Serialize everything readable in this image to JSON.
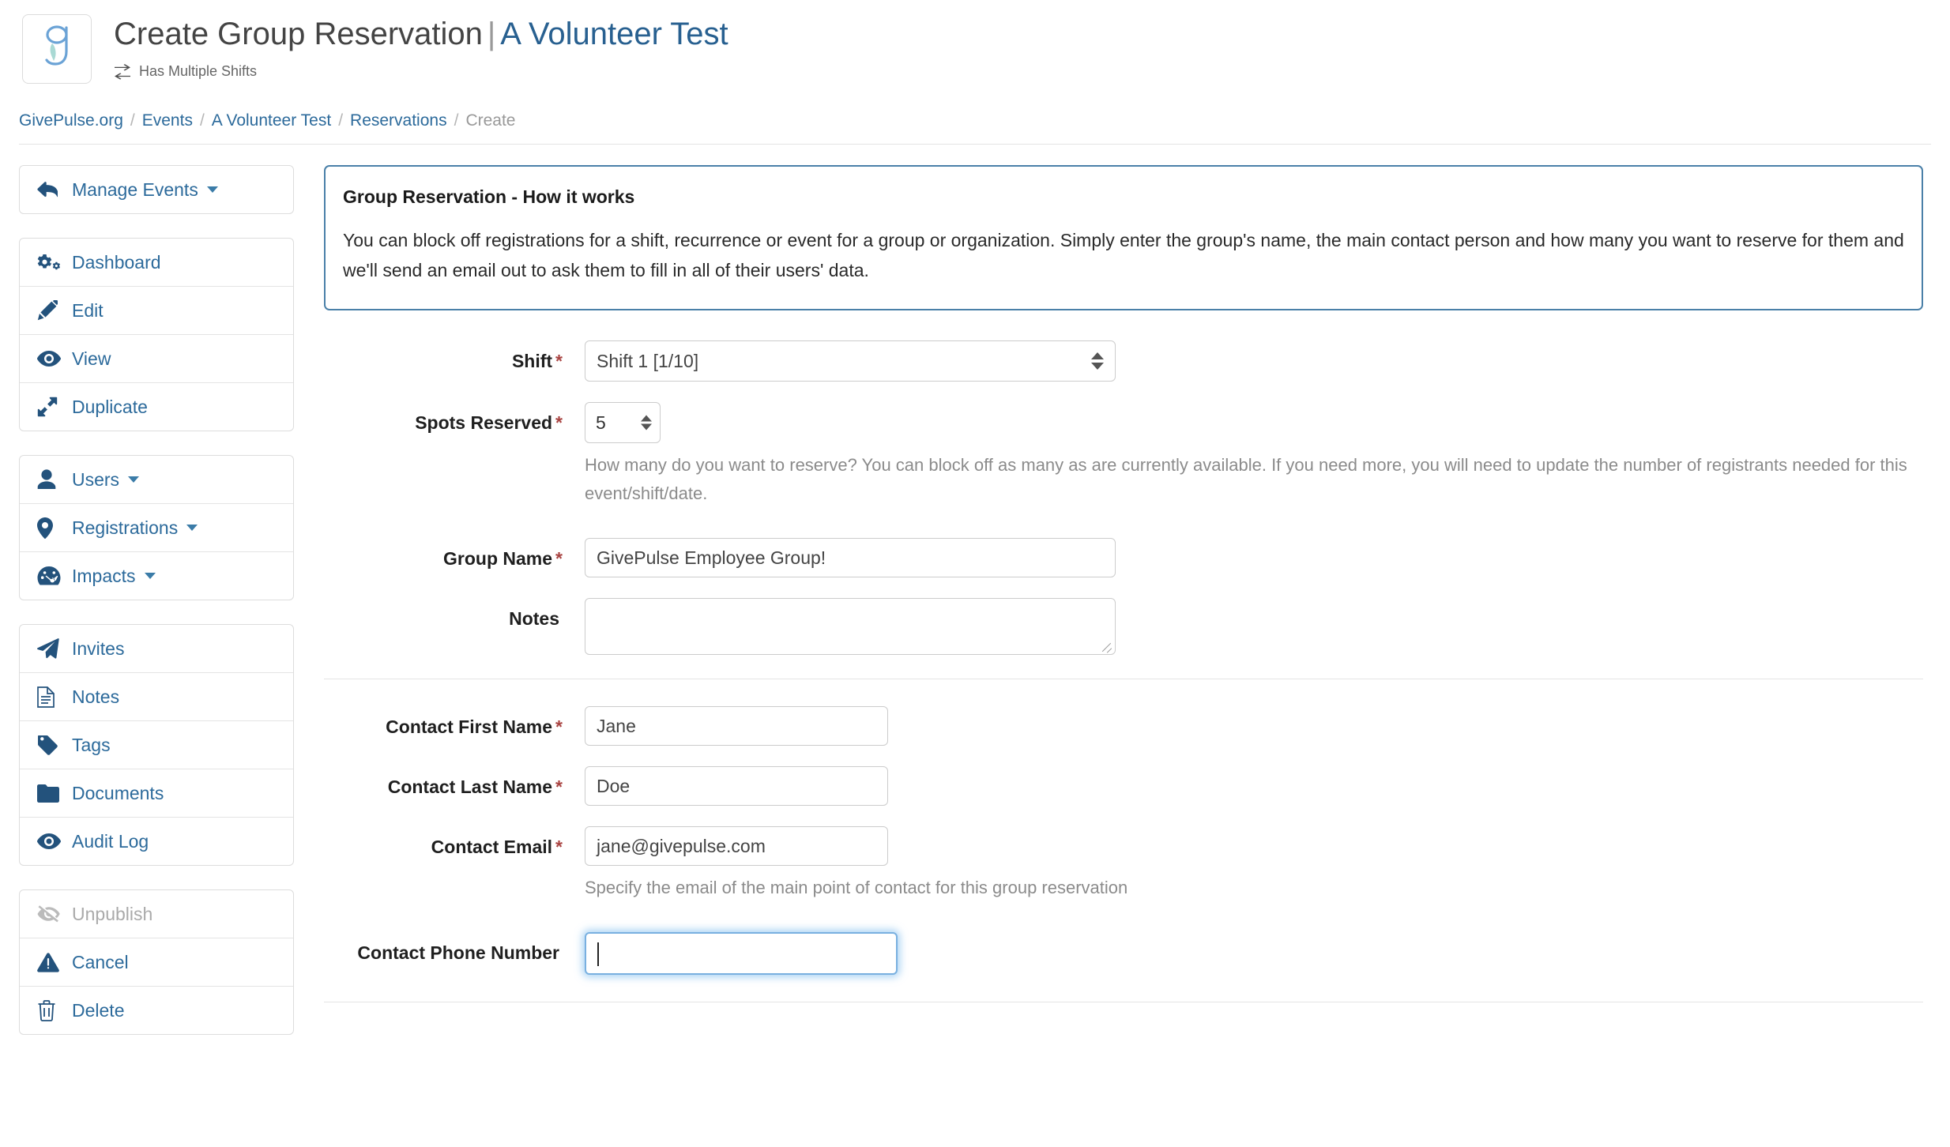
{
  "header": {
    "logo_icon": "givepulse-g-logo",
    "title_main": "Create Group Reservation",
    "title_separator": "|",
    "title_sub": "A Volunteer Test",
    "badge_icon": "exchange-arrows-icon",
    "badge_label": "Has Multiple Shifts"
  },
  "breadcrumb": {
    "items": [
      {
        "label": "GivePulse.org",
        "current": false
      },
      {
        "label": "Events",
        "current": false
      },
      {
        "label": "A Volunteer Test",
        "current": false
      },
      {
        "label": "Reservations",
        "current": false
      },
      {
        "label": "Create",
        "current": true
      }
    ],
    "separator": "/"
  },
  "sidebar": {
    "groups": [
      {
        "items": [
          {
            "label": "Manage Events",
            "icon": "back-arrow-icon",
            "caret": true,
            "disabled": false
          }
        ]
      },
      {
        "items": [
          {
            "label": "Dashboard",
            "icon": "gears-icon",
            "caret": false,
            "disabled": false
          },
          {
            "label": "Edit",
            "icon": "pencil-icon",
            "caret": false,
            "disabled": false
          },
          {
            "label": "View",
            "icon": "eye-icon",
            "caret": false,
            "disabled": false
          },
          {
            "label": "Duplicate",
            "icon": "expand-arrows-icon",
            "caret": false,
            "disabled": false
          }
        ]
      },
      {
        "items": [
          {
            "label": "Users",
            "icon": "user-icon",
            "caret": true,
            "disabled": false
          },
          {
            "label": "Registrations",
            "icon": "map-pin-icon",
            "caret": true,
            "disabled": false
          },
          {
            "label": "Impacts",
            "icon": "dashboard-gauge-icon",
            "caret": true,
            "disabled": false
          }
        ]
      },
      {
        "items": [
          {
            "label": "Invites",
            "icon": "paper-plane-icon",
            "caret": false,
            "disabled": false
          },
          {
            "label": "Notes",
            "icon": "document-lines-icon",
            "caret": false,
            "disabled": false
          },
          {
            "label": "Tags",
            "icon": "tag-icon",
            "caret": false,
            "disabled": false
          },
          {
            "label": "Documents",
            "icon": "folder-icon",
            "caret": false,
            "disabled": false
          },
          {
            "label": "Audit Log",
            "icon": "eye-icon",
            "caret": false,
            "disabled": false
          }
        ]
      },
      {
        "items": [
          {
            "label": "Unpublish",
            "icon": "eye-slash-icon",
            "caret": false,
            "disabled": true
          },
          {
            "label": "Cancel",
            "icon": "warning-triangle-icon",
            "caret": false,
            "disabled": false
          },
          {
            "label": "Delete",
            "icon": "trash-icon",
            "caret": false,
            "disabled": false
          }
        ]
      }
    ]
  },
  "info_box": {
    "title": "Group Reservation - How it works",
    "body": "You can block off registrations for a shift, recurrence or event for a group or organization. Simply enter the group's name, the main contact person and how many you want to reserve for them and we'll send an email out to ask them to fill in all of their users' data."
  },
  "form": {
    "shift": {
      "label": "Shift",
      "required": "*",
      "value": "Shift 1 [1/10]"
    },
    "spots_reserved": {
      "label": "Spots Reserved",
      "required": "*",
      "value": "5",
      "help": "How many do you want to reserve? You can block off as many as are currently available. If you need more, you will need to update the number of registrants needed for this event/shift/date."
    },
    "group_name": {
      "label": "Group Name",
      "required": "*",
      "value": "GivePulse Employee Group!"
    },
    "notes": {
      "label": "Notes",
      "required": "",
      "value": ""
    },
    "contact_first_name": {
      "label": "Contact First Name",
      "required": "*",
      "value": "Jane"
    },
    "contact_last_name": {
      "label": "Contact Last Name",
      "required": "*",
      "value": "Doe"
    },
    "contact_email": {
      "label": "Contact Email",
      "required": "*",
      "value": "jane@givepulse.com",
      "help": "Specify the email of the main point of contact for this group reservation"
    },
    "contact_phone": {
      "label": "Contact Phone Number",
      "required": "",
      "value": ""
    }
  },
  "colors": {
    "link_blue": "#2c6a9b",
    "info_border": "#4a80a8",
    "required_red": "#a94442",
    "focus_blue": "#79b0e0",
    "logo_blue": "#6ba3d6",
    "logo_teal": "#a9d9d4"
  }
}
